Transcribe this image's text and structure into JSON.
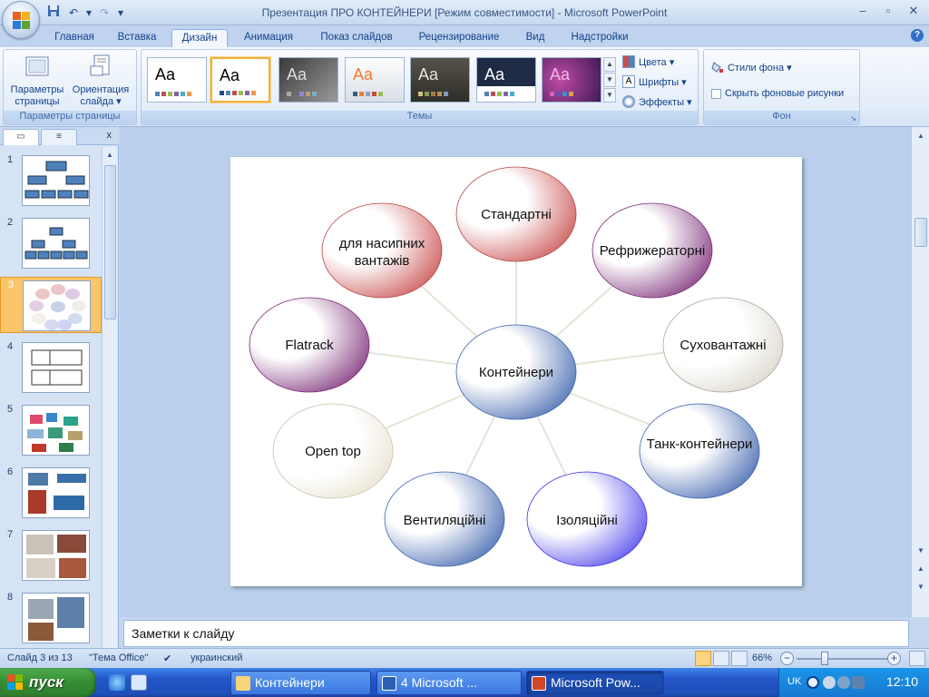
{
  "window": {
    "title": "Презентация ПРО КОНТЕЙНЕРИ [Режим совместимости] - Microsoft PowerPoint",
    "controls": [
      "–",
      "▫",
      "✕"
    ]
  },
  "qat": {
    "save": "save-icon",
    "undo": "↶",
    "redo": "↷",
    "more": "▾"
  },
  "tabs": [
    {
      "label": "Главная"
    },
    {
      "label": "Вставка"
    },
    {
      "label": "Дизайн",
      "active": true
    },
    {
      "label": "Анимация"
    },
    {
      "label": "Показ слайдов"
    },
    {
      "label": "Рецензирование"
    },
    {
      "label": "Вид"
    },
    {
      "label": "Надстройки"
    }
  ],
  "ribbon": {
    "page_setup": {
      "params_label": "Параметры страницы",
      "orientation_label": "Ориентация слайда ▾",
      "group_label": "Параметры страницы"
    },
    "themes": {
      "group_label": "Темы",
      "thumb_text": "Aa",
      "colors_label": "Цвета ▾",
      "fonts_label": "Шрифты ▾",
      "effects_label": "Эффекты ▾"
    },
    "background": {
      "styles_label": "Стили фона ▾",
      "hide_label": "Скрыть фоновые рисунки",
      "group_label": "Фон"
    }
  },
  "slides_panel": {
    "numbers": [
      "1",
      "2",
      "3",
      "4",
      "5",
      "6",
      "7",
      "8"
    ],
    "selected": "3",
    "close": "x"
  },
  "slide": {
    "center": "Контейнери",
    "nodes": [
      "Стандартні",
      "Рефрижераторні",
      "Суховантажні",
      "Танк-контейнери",
      "Ізоляційні",
      "Вентиляційні",
      "Open top",
      "Flatrack",
      "для насипних вантажів"
    ]
  },
  "notes": {
    "placeholder": "Заметки к слайду"
  },
  "status": {
    "slide_counter": "Слайд 3 из 13",
    "theme": "\"Тема Office\"",
    "language": "украинский",
    "zoom": "66%"
  },
  "taskbar": {
    "start": "пуск",
    "tasks": [
      {
        "label": "Контейнери"
      },
      {
        "label": "4 Microsoft ..."
      },
      {
        "label": "Microsoft Pow..."
      }
    ],
    "lang": "UK",
    "clock": "12:10"
  }
}
